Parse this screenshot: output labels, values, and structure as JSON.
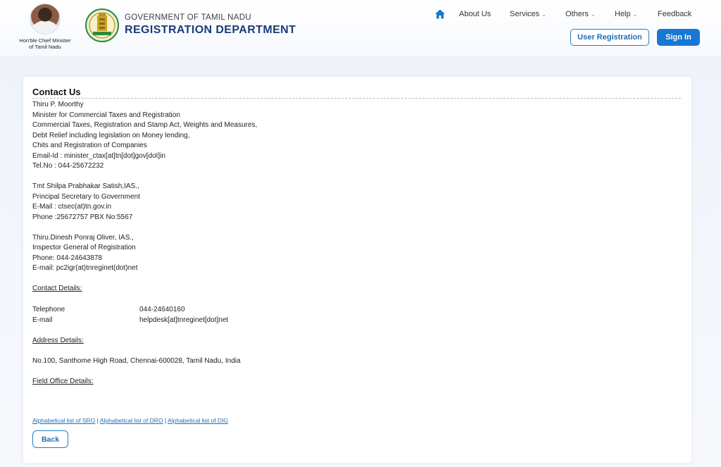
{
  "header": {
    "cm_caption_line1": "Hon'ble Chief Minister",
    "cm_caption_line2": "of Tamil Nadu",
    "gov_title": "GOVERNMENT OF TAMIL NADU",
    "dept_title": "REGISTRATION DEPARTMENT"
  },
  "nav": {
    "home_icon": "home-icon",
    "items": [
      {
        "label": "About Us",
        "dropdown": false
      },
      {
        "label": "Services",
        "dropdown": true
      },
      {
        "label": "Others",
        "dropdown": true
      },
      {
        "label": "Help",
        "dropdown": true
      },
      {
        "label": "Feedback",
        "dropdown": false
      }
    ],
    "caret": "⌄",
    "user_registration": "User Registration",
    "sign_in": "Sign In"
  },
  "colors": {
    "brand_blue": "#1877d2",
    "dept_title": "#1a3c78"
  },
  "contact": {
    "title": "Contact Us",
    "minister": {
      "name": "Thiru P. Moorthy",
      "role1": "Minister for Commercial Taxes and Registration",
      "role2": "Commercial Taxes, Registration and Stamp Act, Weights and Measures,",
      "role3": "Debt Relief including legislation on Money lending,",
      "role4": "Chits and Registration of Companies",
      "email": "Email-Id : minister_ctax[at]tn[dot]gov[dot]in",
      "tel": "Tel.No : 044-25672232"
    },
    "secretary": {
      "name": "Tmt Shilpa Prabhakar Satish,IAS.,",
      "role": "Principal Secretary to Government",
      "email": "E-Mail : ctsec(at)tn.gov.in",
      "phone": "Phone :25672757 PBX No:5567"
    },
    "igr": {
      "name": "Thiru.Dinesh Ponraj Oliver, IAS.,",
      "role": "Inspector General of Registration",
      "phone": "Phone: 044-24643878",
      "email": "E-mail: pc2igr(at)tnreginet(dot)net"
    },
    "contact_details_head": "Contact Details:",
    "telephone_label": "Telephone",
    "telephone_value": "044-24640160",
    "email_label": "E-mail",
    "email_value": "helpdesk[at]tnreginet[dot]net",
    "address_head": "Address Details:",
    "address": "No.100, Santhome High Road, Chennai-600028, Tamil Nadu, India",
    "field_office_head": "Field Office Details:",
    "links": [
      "Alphabetical list of SRO",
      "Alphabetical list of DRO",
      "Alphabetical list of DIG"
    ],
    "separator": "|",
    "back": "Back"
  }
}
